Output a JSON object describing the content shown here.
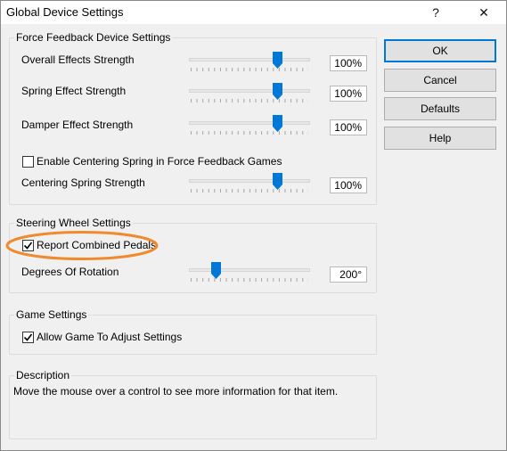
{
  "window": {
    "title": "Global Device Settings",
    "help_glyph": "?",
    "close_glyph": "✕"
  },
  "force_feedback": {
    "group_title": "Force Feedback Device Settings",
    "overall": {
      "label": "Overall Effects Strength",
      "value": "100%",
      "level": 0.75
    },
    "spring": {
      "label": "Spring Effect Strength",
      "value": "100%",
      "level": 0.75
    },
    "damper": {
      "label": "Damper Effect Strength",
      "value": "100%",
      "level": 0.75
    },
    "centering_checkbox": {
      "label": "Enable Centering Spring in Force Feedback Games",
      "checked": false
    },
    "centering": {
      "label": "Centering Spring Strength",
      "value": "100%",
      "level": 0.75
    }
  },
  "steering": {
    "group_title": "Steering Wheel Settings",
    "combined_pedals": {
      "label": "Report Combined Pedals",
      "checked": true
    },
    "rotation": {
      "label": "Degrees Of Rotation",
      "value": "200°",
      "level": 0.2
    }
  },
  "game": {
    "group_title": "Game Settings",
    "allow_game": {
      "label": "Allow Game To Adjust Settings",
      "checked": true
    }
  },
  "description": {
    "group_title": "Description",
    "text": "Move the mouse over a control to see more information for that item."
  },
  "buttons": {
    "ok": "OK",
    "cancel": "Cancel",
    "defaults": "Defaults",
    "help": "Help"
  },
  "colors": {
    "accent": "#0078d7",
    "highlight": "#f08a2c"
  }
}
